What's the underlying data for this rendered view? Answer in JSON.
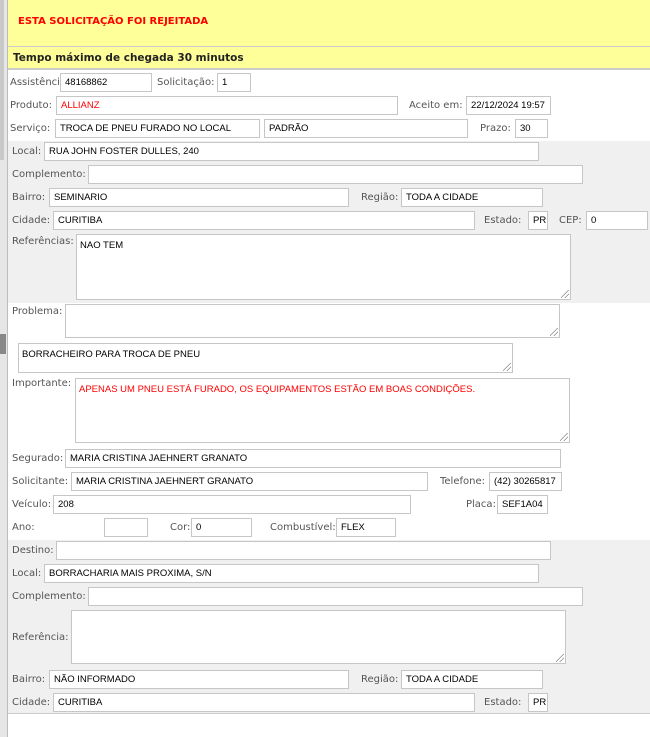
{
  "banner": {
    "title": "ESTA SOLICITAÇÃO FOI REJEITADA",
    "subtitle": "Tempo máximo de chegada 30 minutos"
  },
  "colors": {
    "banner_bg": "#ffff99",
    "alert_text": "#ff0000",
    "section_bg": "#f0f0f0"
  },
  "labels": {
    "assistencia": "Assistência:",
    "solicitacao": "Solicitação:",
    "produto": "Produto:",
    "aceito": "Aceito em:",
    "servico": "Serviço:",
    "prazo": "Prazo:",
    "local": "Local:",
    "complemento": "Complemento:",
    "bairro": "Bairro:",
    "regiao": "Região:",
    "cidade": "Cidade:",
    "estado": "Estado:",
    "cep": "CEP:",
    "referencias": "Referências:",
    "problema": "Problema:",
    "importante": "Importante:",
    "segurado": "Segurado:",
    "solicitante": "Solicitante:",
    "telefone": "Telefone:",
    "veiculo": "Veículo:",
    "placa": "Placa:",
    "ano": "Ano:",
    "cor": "Cor:",
    "combustivel": "Combustível:",
    "destino": "Destino:",
    "d_local": "Local:",
    "d_complemento": "Complemento:",
    "d_referencia": "Referência:",
    "d_bairro": "Bairro:",
    "d_regiao": "Região:",
    "d_cidade": "Cidade:",
    "d_estado": "Estado:"
  },
  "fields": {
    "assistencia": "48168862",
    "solicitacao": "1",
    "produto": "ALLIANZ",
    "aceito": "22/12/2024 19:57",
    "servico": "TROCA DE PNEU FURADO NO LOCAL",
    "servico_tipo": "PADRÃO",
    "prazo": "30",
    "local": "RUA JOHN FOSTER DULLES, 240",
    "complemento": "",
    "bairro": "SEMINARIO",
    "regiao": "TODA A CIDADE",
    "cidade": "CURITIBA",
    "estado": "PR",
    "cep": "0",
    "referencias": "NAO TEM",
    "problema": "",
    "problema_desc": "BORRACHEIRO PARA TROCA DE PNEU",
    "importante": "APENAS UM PNEU ESTÁ FURADO,  OS EQUIPAMENTOS ESTÃO EM BOAS CONDIÇÕES.",
    "segurado": "MARIA CRISTINA JAEHNERT GRANATO",
    "solicitante": "MARIA CRISTINA JAEHNERT GRANATO",
    "telefone": "(42) 30265817",
    "veiculo": "208",
    "placa": "SEF1A04",
    "ano": "",
    "cor": "0",
    "combustivel": "FLEX",
    "destino": "",
    "d_local": "BORRACHARIA MAIS PROXIMA, S/N",
    "d_complemento": "",
    "d_referencia": "",
    "d_bairro": "NÃO INFORMADO",
    "d_regiao": "TODA A CIDADE",
    "d_cidade": "CURITIBA",
    "d_estado": "PR"
  }
}
